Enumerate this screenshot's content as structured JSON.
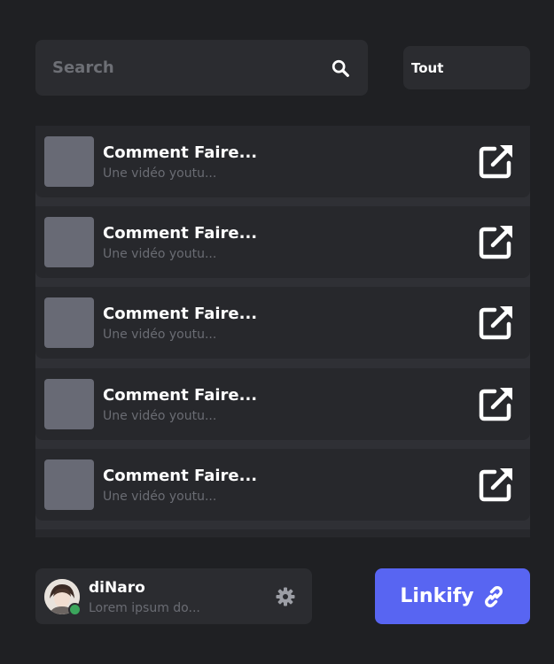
{
  "search": {
    "placeholder": "Search",
    "value": ""
  },
  "filter": {
    "selected": "Tout"
  },
  "items": [
    {
      "title": "Comment Faire...",
      "subtitle": "Une vidéo youtu..."
    },
    {
      "title": "Comment Faire...",
      "subtitle": "Une vidéo youtu..."
    },
    {
      "title": "Comment Faire...",
      "subtitle": "Une vidéo youtu..."
    },
    {
      "title": "Comment Faire...",
      "subtitle": "Une vidéo youtu..."
    },
    {
      "title": "Comment Faire...",
      "subtitle": "Une vidéo youtu..."
    }
  ],
  "user": {
    "name": "diNaro",
    "status_text": "Lorem ipsum do...",
    "online": true
  },
  "linkify": {
    "label": "Linkify"
  },
  "colors": {
    "background": "#1f2023",
    "card": "#2b2c30",
    "accent": "#5865f2",
    "online": "#3ba55c",
    "muted_text": "#6a6c73",
    "thumbnail": "#686a75"
  },
  "icons": {
    "search": "search-icon",
    "open": "external-link-icon",
    "settings": "gear-icon",
    "linkify": "link-icon"
  }
}
